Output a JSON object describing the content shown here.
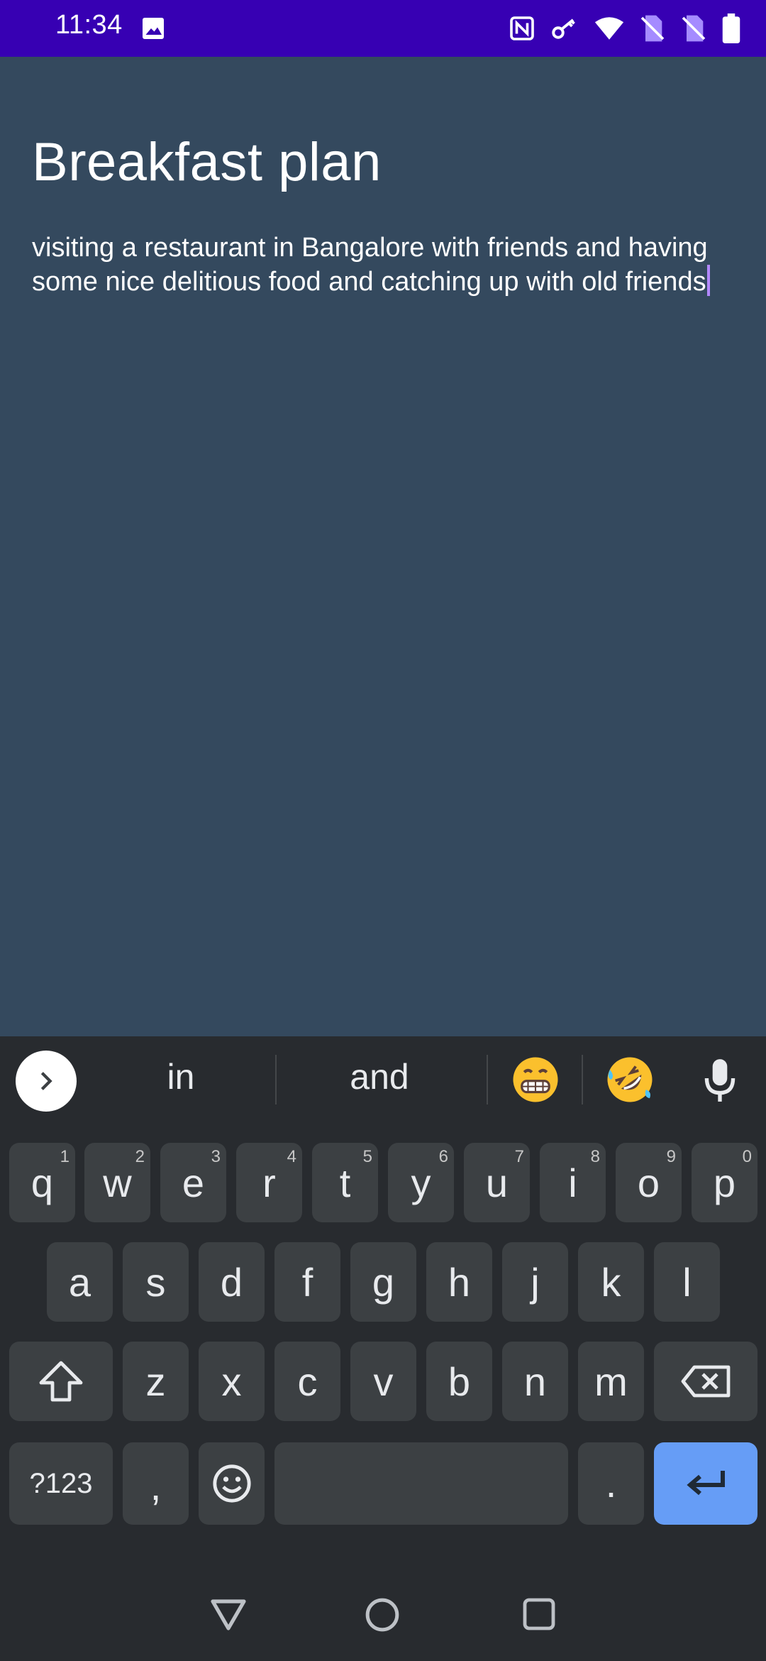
{
  "status_bar": {
    "time": "11:34",
    "icons": [
      "gallery-icon",
      "nfc-icon",
      "vpn-key-icon",
      "wifi-icon",
      "no-sim-icon",
      "no-sim-icon",
      "battery-icon"
    ]
  },
  "note": {
    "title": "Breakfast plan",
    "body": "visiting a restaurant in Bangalore with friends and having some nice delitious food and catching up with old friends"
  },
  "keyboard": {
    "suggestions": [
      "in",
      "and"
    ],
    "emoji_suggestions": [
      "grinning-face-emoji",
      "rolling-laughing-emoji"
    ],
    "row1": [
      {
        "label": "q",
        "hint": "1"
      },
      {
        "label": "w",
        "hint": "2"
      },
      {
        "label": "e",
        "hint": "3"
      },
      {
        "label": "r",
        "hint": "4"
      },
      {
        "label": "t",
        "hint": "5"
      },
      {
        "label": "y",
        "hint": "6"
      },
      {
        "label": "u",
        "hint": "7"
      },
      {
        "label": "i",
        "hint": "8"
      },
      {
        "label": "o",
        "hint": "9"
      },
      {
        "label": "p",
        "hint": "0"
      }
    ],
    "row2": [
      "a",
      "s",
      "d",
      "f",
      "g",
      "h",
      "j",
      "k",
      "l"
    ],
    "row3": [
      "z",
      "x",
      "c",
      "v",
      "b",
      "n",
      "m"
    ],
    "symbols_label": "?123",
    "comma_label": ",",
    "period_label": ".",
    "accent_color": "#669df6"
  },
  "colors": {
    "status_bar": "#3700b3",
    "note_background": "#34495e",
    "keyboard_background": "#282b2f",
    "key_background": "#3c4043",
    "cursor": "#b388ff"
  }
}
